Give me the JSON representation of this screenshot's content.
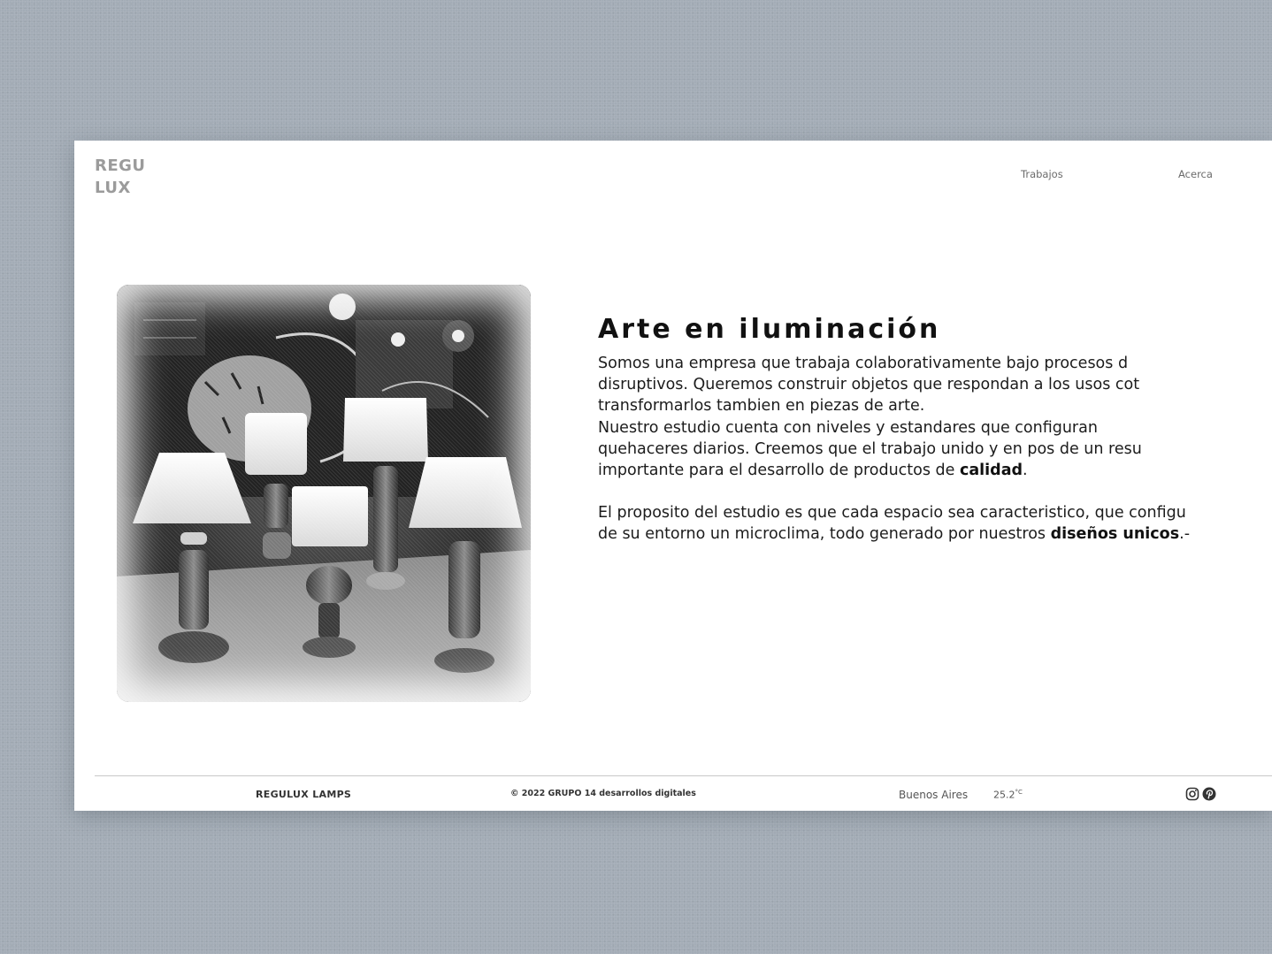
{
  "header": {
    "logo_line1": "REGU",
    "logo_line2": "LUX",
    "nav": [
      {
        "label": "Trabajos"
      },
      {
        "label": "Acerca"
      }
    ]
  },
  "hero": {
    "image_alt": "lamps-photo",
    "title": "Arte en iluminación",
    "paragraph1_lines": [
      "Somos una empresa que trabaja colaborativamente bajo procesos d",
      "disruptivos. Queremos construir objetos que respondan a los usos cot",
      "transformarlos tambien en piezas de arte.",
      "Nuestro estudio cuenta con niveles y estandares que configuran",
      "quehaceres diarios. Creemos que el trabajo unido y en pos de un resu"
    ],
    "paragraph1_last_pre": "importante para el desarrollo de productos de ",
    "paragraph1_last_bold": "calidad",
    "paragraph1_last_post": ".",
    "paragraph2_line1": "El proposito del estudio es que cada espacio sea caracteristico, que configu",
    "paragraph2_last_pre": "de su entorno un microclima, todo generado por nuestros ",
    "paragraph2_last_bold": "diseños unicos",
    "paragraph2_last_post": ".-"
  },
  "footer": {
    "brand": "REGULUX LAMPS",
    "copyright": "© 2022 GRUPO 14 desarrollos digitales",
    "city": "Buenos Aires",
    "temperature": "25.2",
    "temperature_unit": "°C",
    "social": [
      "instagram-icon",
      "pinterest-icon"
    ]
  },
  "colors": {
    "page_background": "#a3acb6",
    "window_background": "#ffffff",
    "logo": "#9b9b9b",
    "text": "#1c1c1c"
  }
}
